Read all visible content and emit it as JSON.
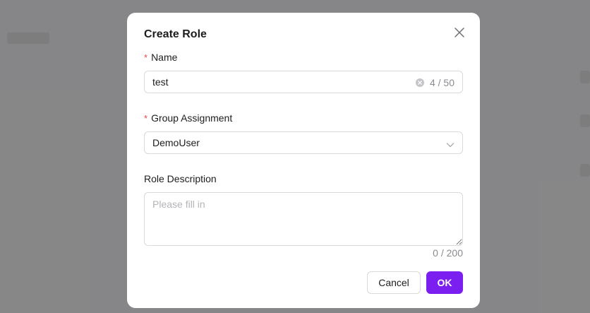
{
  "modal": {
    "title": "Create Role",
    "close_icon": "close-icon"
  },
  "form": {
    "name": {
      "label": "Name",
      "required_mark": "*",
      "value": "test",
      "count": "4 / 50",
      "clear_icon": "clear-circle-icon"
    },
    "group": {
      "label": "Group Assignment",
      "required_mark": "*",
      "selected": "DemoUser",
      "chevron_icon": "chevron-down-icon"
    },
    "description": {
      "label": "Role Description",
      "placeholder": "Please fill in",
      "value": "",
      "count": "0 / 200"
    }
  },
  "footer": {
    "cancel_label": "Cancel",
    "ok_label": "OK"
  },
  "colors": {
    "primary": "#7b1ff0",
    "required": "#e5484d",
    "overlay": "rgba(0,0,0,0.45)"
  }
}
